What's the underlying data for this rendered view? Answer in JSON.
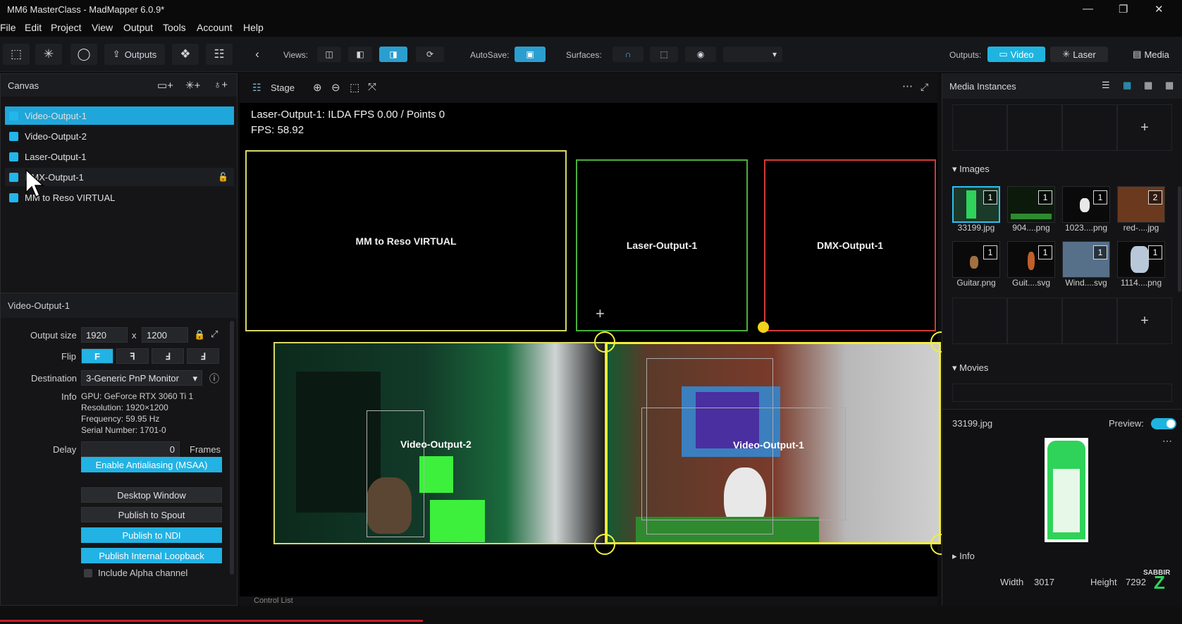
{
  "window": {
    "title": "MM6 MasterClass - MadMapper 6.0.9*",
    "minimize": "—",
    "maximize": "❐",
    "close": "✕"
  },
  "menu": [
    "File",
    "Edit",
    "Project",
    "View",
    "Output",
    "Tools",
    "Account",
    "Help"
  ],
  "toolbar": {
    "outputs_label": "Outputs",
    "views_label": "Views:",
    "autosave_label": "AutoSave:",
    "surfaces_label": "Surfaces:",
    "outputs_right_label": "Outputs:",
    "video_label": "Video",
    "laser_label": "Laser",
    "media_label": "Media"
  },
  "canvas": {
    "header": "Canvas",
    "layers": [
      {
        "label": "Video-Output-1",
        "selected": true
      },
      {
        "label": "Video-Output-2",
        "selected": false
      },
      {
        "label": "Laser-Output-1",
        "selected": false
      },
      {
        "label": "DMX-Output-1",
        "selected": false
      },
      {
        "label": "MM to Reso VIRTUAL",
        "selected": false
      }
    ]
  },
  "properties": {
    "header": "Video-Output-1",
    "output_size_label": "Output size",
    "width": "1920",
    "x_sep": "x",
    "height": "1200",
    "flip_label": "Flip",
    "flip_options": [
      "F",
      "ꟻ",
      "Ⅎ",
      "Ⅎ"
    ],
    "destination_label": "Destination",
    "destination_value": "3-Generic PnP Monitor",
    "info_label": "Info",
    "info_lines": [
      "GPU: GeForce RTX 3060 Ti 1",
      "Resolution: 1920×1200",
      "Frequency: 59.95 Hz",
      "Serial Number: 1701-0"
    ],
    "delay_label": "Delay",
    "delay_value": "0",
    "delay_unit": "Frames",
    "buttons": [
      {
        "label": "Enable Antialiasing (MSAA)",
        "active": true
      },
      {
        "label": "Desktop Window",
        "active": false
      },
      {
        "label": "Publish to Spout",
        "active": false
      },
      {
        "label": "Publish to NDI",
        "active": true
      },
      {
        "label": "Publish Internal Loopback",
        "active": true
      }
    ],
    "alpha_label": "Include Alpha channel"
  },
  "stage": {
    "tab_label": "Stage",
    "overlay_line1": "Laser-Output-1: ILDA FPS 0.00 / Points 0",
    "overlay_line2": "FPS: 58.92",
    "outputs": [
      {
        "label": "MM to Reso VIRTUAL",
        "color": "#d8d868"
      },
      {
        "label": "Laser-Output-1",
        "color": "#4caf3c"
      },
      {
        "label": "DMX-Output-1",
        "color": "#d23a3a"
      },
      {
        "label": "Video-Output-2",
        "color": "#d8d868"
      },
      {
        "label": "Video-Output-1",
        "color": "#f2ee3c"
      }
    ],
    "bottom_tab": "Control List"
  },
  "media": {
    "header": "Media Instances",
    "images_section": "Images",
    "images": [
      {
        "label": "33199.jpg",
        "count": "1",
        "color": "#1a3a2a"
      },
      {
        "label": "904....png",
        "count": "1",
        "color": "#0b1a0b"
      },
      {
        "label": "1023....png",
        "count": "1",
        "color": "#0a0a0a"
      },
      {
        "label": "red-....jpg",
        "count": "2",
        "color": "#6b3a1e"
      },
      {
        "label": "Guitar.png",
        "count": "1",
        "color": "#0a0a0a"
      },
      {
        "label": "Guit....svg",
        "count": "1",
        "color": "#0a0a0a"
      },
      {
        "label": "Wind....svg",
        "count": "1",
        "color": "#56708a"
      },
      {
        "label": "1114....png",
        "count": "1",
        "color": "#0a0a0a"
      }
    ],
    "movies_section": "Movies",
    "selected_name": "33199.jpg",
    "preview_label": "Preview:",
    "info_section": "Info",
    "width_label": "Width",
    "width_value": "3017",
    "height_label": "Height",
    "height_value": "7292",
    "watermark": "SABBIR"
  },
  "colors": {
    "accent": "#1fb4e0",
    "panel": "#151517",
    "yellow": "#f2ee3c"
  }
}
